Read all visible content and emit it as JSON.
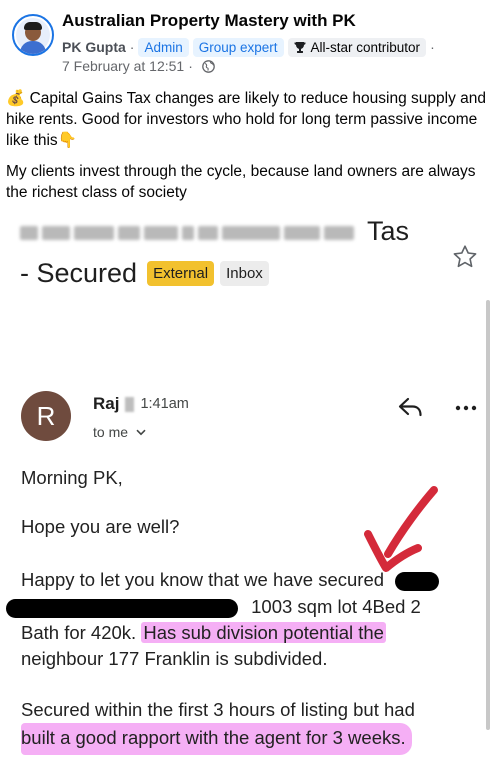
{
  "post": {
    "group_name": "Australian Property Mastery with PK",
    "author": "PK Gupta",
    "separator": "·",
    "badges": [
      "Admin",
      "Group expert",
      "All-star contributor"
    ],
    "date": "7 February at 12:51",
    "paragraph_1": "💰 Capital Gains Tax changes are likely to reduce housing supply and hike rents. Good for investors who hold for long term passive income like this👇",
    "paragraph_2": "My clients invest through the cycle, because land owners are always the richest class of society"
  },
  "email": {
    "subject_end": "Tas",
    "subject_line2": "- Secured",
    "labels": {
      "external": "External",
      "inbox": "Inbox"
    },
    "sender": {
      "initial": "R",
      "name": "Raj",
      "time": "1:41am",
      "to": "to me"
    },
    "body": {
      "greeting": "Morning PK,",
      "line_hope": "Hope you are well?",
      "line_happy": "Happy to let you know that we have secured",
      "line_lot": "1003 sqm lot 4Bed 2",
      "line_bath": "Bath for 420k.",
      "line_subdiv": "Has sub division potential the",
      "line_neighbour": "neighbour 177 Franklin is subdivided.",
      "line_secured": "Secured within the first 3 hours of listing but had",
      "line_rapport": "built a good rapport with the agent for 3 weeks."
    }
  },
  "colors": {
    "facebook_blue": "#1b74e4",
    "external_label": "#f2c12e",
    "highlight": "#ec6eec",
    "arrow_red": "#d42a3a",
    "avatar_brown": "#6f4b3e"
  },
  "icons": [
    "trophy-icon",
    "globe-icon",
    "star-icon",
    "reply-icon",
    "more-icon",
    "chevron-down-icon",
    "hand-drawn-arrow"
  ]
}
